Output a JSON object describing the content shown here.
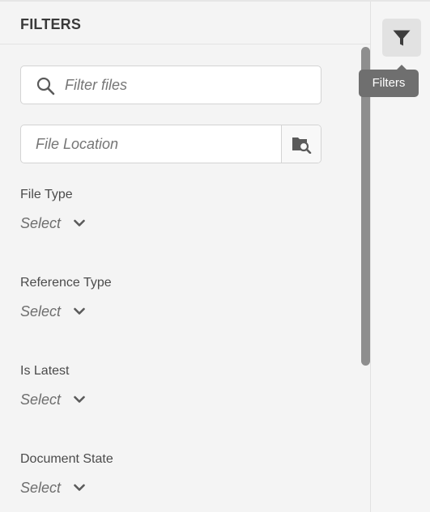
{
  "panel": {
    "title": "FILTERS",
    "search": {
      "placeholder": "Filter files",
      "value": ""
    },
    "location": {
      "placeholder": "File Location",
      "value": ""
    },
    "filters": [
      {
        "label": "File Type",
        "value": "Select"
      },
      {
        "label": "Reference Type",
        "value": "Select"
      },
      {
        "label": "Is Latest",
        "value": "Select"
      },
      {
        "label": "Document State",
        "value": "Select"
      }
    ]
  },
  "rail": {
    "toggle_icon": "filter-funnel-icon",
    "tooltip": "Filters"
  },
  "icons": {
    "search": "magnifier-icon",
    "browse": "folder-search-icon",
    "dropdown": "chevron-down-icon"
  },
  "colors": {
    "panel_bg": "#f4f4f4",
    "scrollbar": "#8e8e8e",
    "tooltip_bg": "#6f6f6f",
    "toggle_bg": "#e2e2e2"
  }
}
